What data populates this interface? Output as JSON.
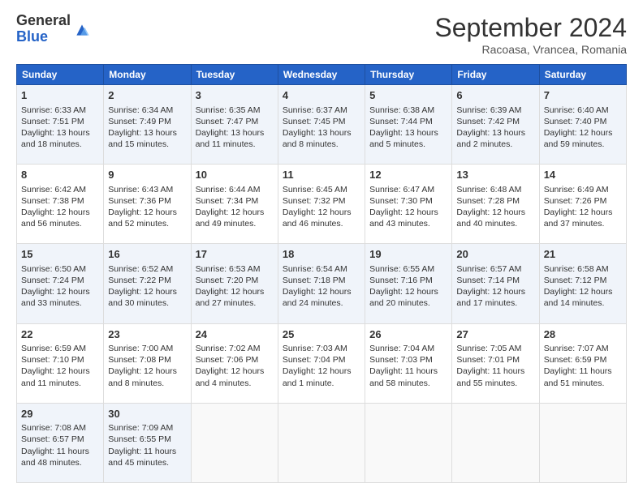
{
  "header": {
    "logo_general": "General",
    "logo_blue": "Blue",
    "title": "September 2024",
    "subtitle": "Racoasa, Vrancea, Romania"
  },
  "days": [
    "Sunday",
    "Monday",
    "Tuesday",
    "Wednesday",
    "Thursday",
    "Friday",
    "Saturday"
  ],
  "weeks": [
    [
      {
        "day": 1,
        "sunrise": "6:33 AM",
        "sunset": "7:51 PM",
        "daylight": "13 hours and 18 minutes."
      },
      {
        "day": 2,
        "sunrise": "6:34 AM",
        "sunset": "7:49 PM",
        "daylight": "13 hours and 15 minutes."
      },
      {
        "day": 3,
        "sunrise": "6:35 AM",
        "sunset": "7:47 PM",
        "daylight": "13 hours and 11 minutes."
      },
      {
        "day": 4,
        "sunrise": "6:37 AM",
        "sunset": "7:45 PM",
        "daylight": "13 hours and 8 minutes."
      },
      {
        "day": 5,
        "sunrise": "6:38 AM",
        "sunset": "7:44 PM",
        "daylight": "13 hours and 5 minutes."
      },
      {
        "day": 6,
        "sunrise": "6:39 AM",
        "sunset": "7:42 PM",
        "daylight": "13 hours and 2 minutes."
      },
      {
        "day": 7,
        "sunrise": "6:40 AM",
        "sunset": "7:40 PM",
        "daylight": "12 hours and 59 minutes."
      }
    ],
    [
      {
        "day": 8,
        "sunrise": "6:42 AM",
        "sunset": "7:38 PM",
        "daylight": "12 hours and 56 minutes."
      },
      {
        "day": 9,
        "sunrise": "6:43 AM",
        "sunset": "7:36 PM",
        "daylight": "12 hours and 52 minutes."
      },
      {
        "day": 10,
        "sunrise": "6:44 AM",
        "sunset": "7:34 PM",
        "daylight": "12 hours and 49 minutes."
      },
      {
        "day": 11,
        "sunrise": "6:45 AM",
        "sunset": "7:32 PM",
        "daylight": "12 hours and 46 minutes."
      },
      {
        "day": 12,
        "sunrise": "6:47 AM",
        "sunset": "7:30 PM",
        "daylight": "12 hours and 43 minutes."
      },
      {
        "day": 13,
        "sunrise": "6:48 AM",
        "sunset": "7:28 PM",
        "daylight": "12 hours and 40 minutes."
      },
      {
        "day": 14,
        "sunrise": "6:49 AM",
        "sunset": "7:26 PM",
        "daylight": "12 hours and 37 minutes."
      }
    ],
    [
      {
        "day": 15,
        "sunrise": "6:50 AM",
        "sunset": "7:24 PM",
        "daylight": "12 hours and 33 minutes."
      },
      {
        "day": 16,
        "sunrise": "6:52 AM",
        "sunset": "7:22 PM",
        "daylight": "12 hours and 30 minutes."
      },
      {
        "day": 17,
        "sunrise": "6:53 AM",
        "sunset": "7:20 PM",
        "daylight": "12 hours and 27 minutes."
      },
      {
        "day": 18,
        "sunrise": "6:54 AM",
        "sunset": "7:18 PM",
        "daylight": "12 hours and 24 minutes."
      },
      {
        "day": 19,
        "sunrise": "6:55 AM",
        "sunset": "7:16 PM",
        "daylight": "12 hours and 20 minutes."
      },
      {
        "day": 20,
        "sunrise": "6:57 AM",
        "sunset": "7:14 PM",
        "daylight": "12 hours and 17 minutes."
      },
      {
        "day": 21,
        "sunrise": "6:58 AM",
        "sunset": "7:12 PM",
        "daylight": "12 hours and 14 minutes."
      }
    ],
    [
      {
        "day": 22,
        "sunrise": "6:59 AM",
        "sunset": "7:10 PM",
        "daylight": "12 hours and 11 minutes."
      },
      {
        "day": 23,
        "sunrise": "7:00 AM",
        "sunset": "7:08 PM",
        "daylight": "12 hours and 8 minutes."
      },
      {
        "day": 24,
        "sunrise": "7:02 AM",
        "sunset": "7:06 PM",
        "daylight": "12 hours and 4 minutes."
      },
      {
        "day": 25,
        "sunrise": "7:03 AM",
        "sunset": "7:04 PM",
        "daylight": "12 hours and 1 minute."
      },
      {
        "day": 26,
        "sunrise": "7:04 AM",
        "sunset": "7:03 PM",
        "daylight": "11 hours and 58 minutes."
      },
      {
        "day": 27,
        "sunrise": "7:05 AM",
        "sunset": "7:01 PM",
        "daylight": "11 hours and 55 minutes."
      },
      {
        "day": 28,
        "sunrise": "7:07 AM",
        "sunset": "6:59 PM",
        "daylight": "11 hours and 51 minutes."
      }
    ],
    [
      {
        "day": 29,
        "sunrise": "7:08 AM",
        "sunset": "6:57 PM",
        "daylight": "11 hours and 48 minutes."
      },
      {
        "day": 30,
        "sunrise": "7:09 AM",
        "sunset": "6:55 PM",
        "daylight": "11 hours and 45 minutes."
      },
      null,
      null,
      null,
      null,
      null
    ]
  ]
}
